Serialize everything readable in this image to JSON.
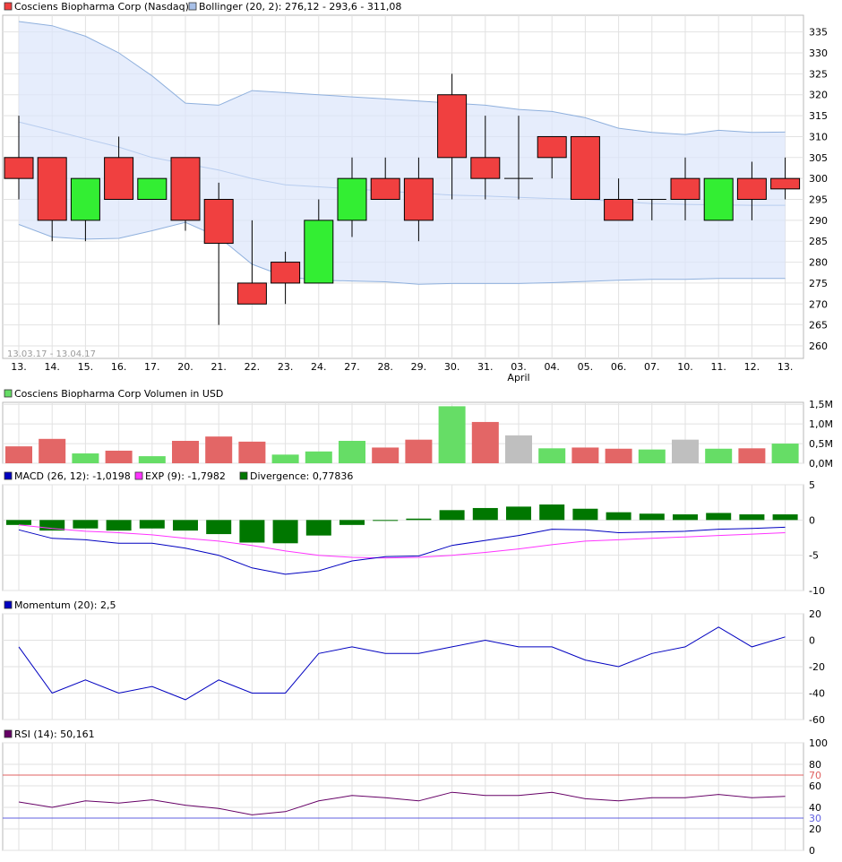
{
  "chart_data": [
    {
      "type": "candlestick",
      "legend": [
        {
          "label": "Cosciens Biopharma Corp (Nasdaq)",
          "color": "#f04040"
        },
        {
          "label": "Bollinger (20, 2): 276,12 - 293,6 - 311,08",
          "color": "#a8c0e8"
        }
      ],
      "date_range_label": "13.03.17 - 13.04.17",
      "x_labels": [
        "13.",
        "14.",
        "15.",
        "16.",
        "17.",
        "20.",
        "21.",
        "22.",
        "23.",
        "24.",
        "27.",
        "28.",
        "29.",
        "30.",
        "31.",
        "03.",
        "04.",
        "05.",
        "06.",
        "07.",
        "10.",
        "11.",
        "12.",
        "13."
      ],
      "month_label": {
        "index": 15,
        "text": "April"
      },
      "ylim": [
        257,
        339
      ],
      "y_ticks": [
        260,
        265,
        270,
        275,
        280,
        285,
        290,
        295,
        300,
        305,
        310,
        315,
        320,
        325,
        330,
        335
      ],
      "candles": [
        {
          "o": 305,
          "h": 315,
          "l": 295,
          "c": 300
        },
        {
          "o": 305,
          "h": 305,
          "l": 285,
          "c": 290
        },
        {
          "o": 290,
          "h": 300,
          "l": 285,
          "c": 300
        },
        {
          "o": 305,
          "h": 310,
          "l": 295,
          "c": 295
        },
        {
          "o": 295,
          "h": 300,
          "l": 295,
          "c": 300
        },
        {
          "o": 305,
          "h": 305,
          "l": 287.5,
          "c": 290
        },
        {
          "o": 295,
          "h": 299,
          "l": 265,
          "c": 284.5
        },
        {
          "o": 275,
          "h": 290,
          "l": 270,
          "c": 270
        },
        {
          "o": 280,
          "h": 282.5,
          "l": 270,
          "c": 275
        },
        {
          "o": 275,
          "h": 295,
          "l": 275,
          "c": 290
        },
        {
          "o": 290,
          "h": 305,
          "l": 286,
          "c": 300
        },
        {
          "o": 300,
          "h": 305,
          "l": 295,
          "c": 295
        },
        {
          "o": 300,
          "h": 305,
          "l": 285,
          "c": 290
        },
        {
          "o": 320,
          "h": 325,
          "l": 295,
          "c": 305
        },
        {
          "o": 305,
          "h": 315,
          "l": 295,
          "c": 300
        },
        {
          "o": 300,
          "h": 315,
          "l": 295,
          "c": 300
        },
        {
          "o": 310,
          "h": 310,
          "l": 300,
          "c": 305
        },
        {
          "o": 310,
          "h": 310,
          "l": 295,
          "c": 295
        },
        {
          "o": 295,
          "h": 300,
          "l": 290,
          "c": 290
        },
        {
          "o": 295,
          "h": 295,
          "l": 290,
          "c": 295
        },
        {
          "o": 300,
          "h": 305,
          "l": 290,
          "c": 295
        },
        {
          "o": 290,
          "h": 300,
          "l": 290,
          "c": 300
        },
        {
          "o": 300,
          "h": 304,
          "l": 290,
          "c": 295
        },
        {
          "o": 300,
          "h": 305,
          "l": 295,
          "c": 297.5
        }
      ],
      "bollinger_upper": [
        337.5,
        336.5,
        334,
        330,
        324.5,
        318,
        317.5,
        321,
        320.5,
        320,
        319.5,
        319,
        318.5,
        318,
        317.5,
        316.5,
        316,
        314.5,
        312,
        311,
        310.5,
        311.5,
        311,
        311.08
      ],
      "bollinger_middle": [
        313.5,
        311.5,
        309.5,
        307.5,
        305,
        303.5,
        302,
        300,
        298.5,
        298,
        297.5,
        297,
        296.5,
        296,
        295.8,
        295.5,
        295.2,
        295,
        294.5,
        294,
        293.8,
        293.7,
        293.6,
        293.6
      ],
      "bollinger_lower": [
        289,
        286,
        285.5,
        285.7,
        287.5,
        289.5,
        286,
        279.5,
        276.5,
        275.7,
        275.5,
        275.3,
        274.7,
        274.9,
        274.9,
        274.9,
        275.1,
        275.4,
        275.7,
        275.9,
        275.9,
        276.1,
        276.1,
        276.12
      ]
    },
    {
      "type": "bar",
      "title": "Cosciens Biopharma Corp Volumen in USD",
      "legend_color": "#66dd66",
      "ylim": [
        0,
        1.55
      ],
      "y_tick_values": [
        0,
        0.5,
        1,
        1.5
      ],
      "y_tick_labels": [
        "0,0M",
        "0,5M",
        "1,0M",
        "1,5M"
      ],
      "values": [
        0.43,
        0.62,
        0.25,
        0.32,
        0.18,
        0.57,
        0.68,
        0.55,
        0.22,
        0.3,
        0.57,
        0.4,
        0.6,
        1.45,
        1.05,
        0.71,
        0.38,
        0.4,
        0.37,
        0.35,
        0.6,
        0.37,
        0.38,
        0.5
      ],
      "bar_colors": [
        "#e36666",
        "#e36666",
        "#66dd66",
        "#e36666",
        "#66dd66",
        "#e36666",
        "#e36666",
        "#e36666",
        "#66dd66",
        "#66dd66",
        "#66dd66",
        "#e36666",
        "#e36666",
        "#66dd66",
        "#e36666",
        "#bfbfbf",
        "#66dd66",
        "#e36666",
        "#e36666",
        "#66dd66",
        "#bfbfbf",
        "#66dd66",
        "#e36666",
        "#66dd66"
      ]
    },
    {
      "type": "line",
      "legend": [
        {
          "label": "MACD (26, 12): -1,0198",
          "color": "#0000c0"
        },
        {
          "label": "EXP (9): -1,7982",
          "color": "#ff33ff"
        },
        {
          "label": "Divergence: 0,77836",
          "color": "#007700"
        }
      ],
      "ylim": [
        -10,
        5
      ],
      "y_ticks": [
        -10,
        -5,
        0,
        5
      ],
      "macd": [
        -1.4,
        -2.6,
        -2.8,
        -3.3,
        -3.3,
        -4.0,
        -5.0,
        -6.8,
        -7.7,
        -7.2,
        -5.8,
        -5.2,
        -5.1,
        -3.6,
        -2.9,
        -2.2,
        -1.3,
        -1.4,
        -1.8,
        -1.7,
        -1.6,
        -1.3,
        -1.2,
        -1.02
      ],
      "exp": [
        -0.7,
        -1.2,
        -1.6,
        -1.8,
        -2.1,
        -2.6,
        -3.0,
        -3.6,
        -4.4,
        -5.0,
        -5.3,
        -5.4,
        -5.3,
        -5.0,
        -4.6,
        -4.1,
        -3.5,
        -3.0,
        -2.8,
        -2.6,
        -2.4,
        -2.2,
        -2.0,
        -1.8
      ],
      "divergence": [
        -0.7,
        -1.5,
        -1.2,
        -1.5,
        -1.2,
        -1.5,
        -2.0,
        -3.2,
        -3.3,
        -2.2,
        -0.7,
        -0.1,
        0.2,
        1.4,
        1.7,
        1.9,
        2.2,
        1.6,
        1.1,
        0.9,
        0.8,
        1.0,
        0.8,
        0.8
      ]
    },
    {
      "type": "line",
      "legend": [
        {
          "label": "Momentum (20): 2,5",
          "color": "#0000c0"
        }
      ],
      "ylim": [
        -60,
        20
      ],
      "y_ticks": [
        -60,
        -40,
        -20,
        0,
        20
      ],
      "values": [
        -5,
        -40,
        -30,
        -40,
        -35,
        -45,
        -30,
        -40,
        -40,
        -10,
        -5,
        -10,
        -10,
        -5,
        0,
        -5,
        -5,
        -15,
        -20,
        -10,
        -5,
        10,
        -5,
        2.5
      ]
    },
    {
      "type": "line",
      "legend": [
        {
          "label": "RSI (14): 50,161",
          "color": "#660066"
        }
      ],
      "ylim": [
        0,
        100
      ],
      "y_ticks": [
        0,
        20,
        40,
        60,
        80,
        100
      ],
      "ref_lines": [
        {
          "value": 70,
          "label": "70",
          "color": "#e06060"
        },
        {
          "value": 30,
          "label": "30",
          "color": "#6060e0"
        }
      ],
      "values": [
        45,
        40,
        46,
        44,
        47,
        42,
        39,
        33,
        36,
        46,
        51,
        49,
        46,
        54,
        51,
        51,
        54,
        48,
        46,
        49,
        49,
        52,
        49,
        50.16
      ]
    }
  ]
}
